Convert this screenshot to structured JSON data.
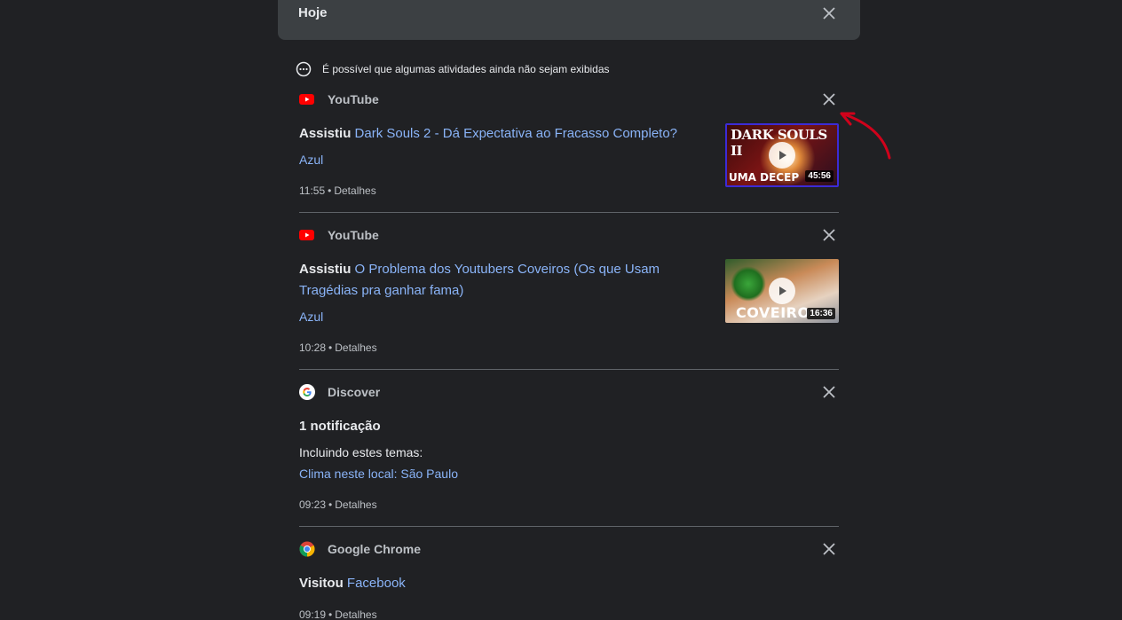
{
  "header": {
    "title": "Hoje"
  },
  "notice": {
    "text": "É possível que algumas atividades ainda não sejam exibidas"
  },
  "cards": [
    {
      "source": "YouTube",
      "verb": "Assistiu",
      "title": "Dark Souls 2 - Dá Expectativa ao Fracasso Completo?",
      "channel": "Azul",
      "time": "11:55",
      "details": "Detalhes",
      "thumb": {
        "line1": "DARK SOULS II",
        "line2": "UMA DECEP",
        "duration": "45:56"
      }
    },
    {
      "source": "YouTube",
      "verb": "Assistiu",
      "title": "O Problema dos Youtubers Coveiros (Os que Usam Tragédias pra ganhar fama)",
      "channel": "Azul",
      "time": "10:28",
      "details": "Detalhes",
      "thumb": {
        "line1": "COVEIRO",
        "duration": "16:36"
      }
    },
    {
      "source": "Discover",
      "heading": "1 notificação",
      "topics_label": "Incluindo estes temas:",
      "topic": "Clima neste local: São Paulo",
      "time": "09:23",
      "details": "Detalhes"
    },
    {
      "source": "Google Chrome",
      "verb": "Visitou",
      "title": "Facebook",
      "time": "09:19",
      "details": "Detalhes"
    }
  ],
  "meta_separator": "•",
  "colors": {
    "background": "#202124",
    "header": "#3c4043",
    "link": "#8ab4f8",
    "annotation": "#d0021b"
  }
}
